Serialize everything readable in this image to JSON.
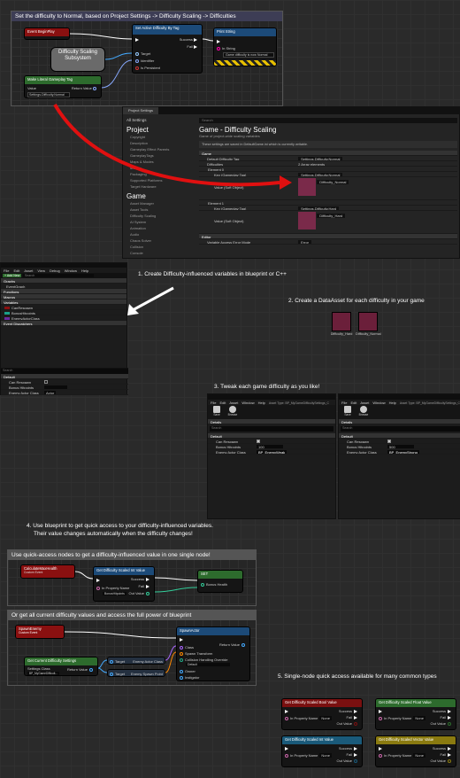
{
  "top_comment": {
    "title": "Set the difficulty to Normal, based on Project Settings -> Difficulty Scaling -> Difficulties",
    "event_begin_play": "Event BeginPlay",
    "subsystem_label": "Difficulty Scaling Subsystem",
    "set_active_node": "Set Active Difficulty By Tag",
    "set_active_sub": "Target is Difficulty Scaling Subsystem",
    "target_pin": "Target",
    "identifier_pin": "Identifier",
    "persistent_pin": "Is Persistent",
    "success_pin": "Success",
    "fail_pin": "Fail",
    "print_node": "Print String",
    "print_sub": "Development Only",
    "print_in_string": "In String",
    "print_value": "Game difficulty is now Normal",
    "make_tag_node": "Make Literal Gameplay Tag",
    "make_tag_value": "Value",
    "make_tag_tag": "Settings.Difficulty.Normal",
    "return_value": "Return Value"
  },
  "project_settings": {
    "tab": "Project Settings",
    "search_placeholder": "Search",
    "all_settings": "All Settings",
    "section_project": "Project",
    "project_links": [
      "Copyright",
      "Description",
      "Gameplay Effect Parents",
      "GameplayTags",
      "Maps & Modes",
      "Movies",
      "Packaging",
      "Supported Platforms",
      "Target Hardware"
    ],
    "section_game": "Game",
    "game_links": [
      "Asset Manager",
      "Asset Tools",
      "Difficulty Scaling",
      "AI System",
      "Animation",
      "Audio",
      "Chaos Solver",
      "Collision",
      "Console"
    ],
    "title": "Game - Difficulty Scaling",
    "subtitle": "Game of project-wide scaling variables",
    "notice": "These settings are saved in DefaultGame.ini which is currently writable.",
    "cat_game": "Game",
    "default_difficulty_tag": "Default Difficulty Tag",
    "default_tag_value": "Settings.Difficulty.Normal",
    "difficulties_label": "Difficulties",
    "difficulties_count": "2 Array elements",
    "element0": "Element 0",
    "element1": "Element 1",
    "key_label": "Key (Gameplay Tag)",
    "key0": "Settings.Difficulty.Normal",
    "key1": "Settings.Difficulty.Hard",
    "value_label": "Value (Soft Object)",
    "value0_asset": "Difficulty_Normal",
    "value1_asset": "Difficulty_Hard",
    "cat_editor": "Editor",
    "editor_row": "Variable Access Error Mode",
    "editor_value": "Error"
  },
  "blueprint_editor": {
    "menu": [
      "File",
      "Edit",
      "Asset",
      "View",
      "Debug",
      "Window",
      "Help"
    ],
    "add_button": "+ Add New",
    "search_placeholder": "Search",
    "sections": [
      "Graphs",
      "EventGraph",
      "Functions",
      "Macros",
      "Variables",
      "Event Dispatchers"
    ],
    "variables": [
      "CanRespawn",
      "BonusHitpoints",
      "EnemyActorClass"
    ],
    "details_search": "Search",
    "default_cat": "Default",
    "details_rows": [
      "Can Respawn",
      "Bonus Hitpoints",
      "Enemy Actor Class"
    ],
    "enemy_class_value": "Actor"
  },
  "steps": {
    "s1": "1. Create Difficulty-influenced variables in blueprint or C++",
    "s2": "2. Create a DataAsset for each difficulty in your game",
    "s3": "3. Tweak each game difficulty as you like!",
    "s4a": "4. Use blueprint to get quick access to your difficulty-influenced variables.",
    "s4b": "Their value changes automatically when the difficulty changes!",
    "s5": "5. Single-node quick access available for many common types"
  },
  "data_assets": [
    "Difficulty_Hard",
    "Difficulty_Normal"
  ],
  "tweak_windows": [
    {
      "menu": [
        "File",
        "Edit",
        "Asset",
        "Window",
        "Help"
      ],
      "asset_type": "Asset Type: BP_MyGameDifficultySettings_C",
      "toolbar": [
        "Save",
        "Browse"
      ],
      "details": "Details",
      "search": "Search",
      "default_cat": "Default",
      "rows": [
        "Can Respawn",
        "Bonus Hitpoints",
        "Enemy Actor Class"
      ],
      "hitpoints": "100",
      "enemy_class": "BP_EnemyWeak"
    },
    {
      "menu": [
        "File",
        "Edit",
        "Asset",
        "Window",
        "Help"
      ],
      "asset_type": "Asset Type: BP_MyGameDifficultySettings_C",
      "toolbar": [
        "Save",
        "Browse"
      ],
      "details": "Details",
      "search": "Search",
      "default_cat": "Default",
      "rows": [
        "Can Respawn",
        "Bonus Hitpoints",
        "Enemy Actor Class"
      ],
      "hitpoints": "500",
      "enemy_class": "BP_EnemyStrong"
    }
  ],
  "quick_access": {
    "comment1": "Use quick-access nodes to get a difficulty-influenced value in one single node!",
    "calc_health": "CalculateMaxHealth",
    "calc_health_sub": "Custom Event",
    "get_float_node": "Get Difficulty Scaled Int Value",
    "in_property_name": "In Property Name",
    "property_value": "BonusHitpoints",
    "set_node": "SET",
    "bonus_health": "Bonus Health",
    "comment2": "Or get all current difficulty values and access the full power of blueprint",
    "spawn_enemy": "SpawnEnemy",
    "spawn_enemy_sub": "Custom Event",
    "get_settings_node": "Get Current Difficulty Settings",
    "settings_class": "Settings Class",
    "settings_value": "BP_MyGameDifficult...",
    "cast_enemy_class": "Enemy Actor Class",
    "cast_enemy_spawn": "Enemy Spawn Point",
    "spawn_actor": "SpawnActor",
    "class_pin": "Class",
    "spawn_transform": "Spawn Transform",
    "collision": "Collision Handling Override",
    "collision_value": "Default",
    "owner": "Owner",
    "instigator": "Instigator",
    "return_value": "Return Value",
    "target": "Target"
  },
  "single_nodes": [
    {
      "title": "Get Difficulty Scaled Bool Value",
      "color": "#7a1010"
    },
    {
      "title": "Get Difficulty Scaled Float Value",
      "color": "#2d6b2d"
    },
    {
      "title": "Get Difficulty Scaled Int Value",
      "color": "#1a5a7a"
    },
    {
      "title": "Get Difficulty Scaled Vector Value",
      "color": "#8a7a10"
    }
  ],
  "single_node_pins": {
    "success": "Success",
    "fail": "Fail",
    "out_value": "Out Value",
    "in_property": "In Property Name",
    "none": "None"
  }
}
